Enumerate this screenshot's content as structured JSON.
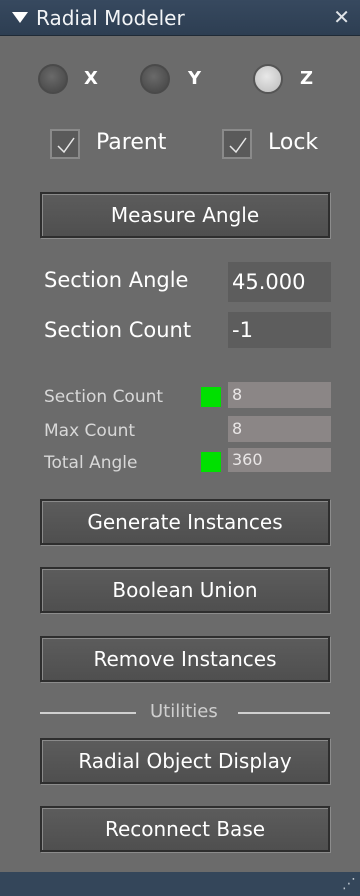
{
  "window": {
    "title": "Radial Modeler"
  },
  "axes": [
    {
      "label": "X",
      "selected": false
    },
    {
      "label": "Y",
      "selected": false
    },
    {
      "label": "Z",
      "selected": true
    }
  ],
  "options": {
    "parent": {
      "label": "Parent",
      "checked": true
    },
    "lock": {
      "label": "Lock",
      "checked": true
    }
  },
  "buttons": {
    "measure_angle": "Measure Angle",
    "generate_instances": "Generate Instances",
    "boolean_union": "Boolean Union",
    "remove_instances": "Remove Instances",
    "radial_object_display": "Radial Object Display",
    "reconnect_base": "Reconnect Base"
  },
  "fields": {
    "section_angle": {
      "label": "Section Angle",
      "value": "45.000"
    },
    "section_count": {
      "label": "Section Count",
      "value": "-1"
    }
  },
  "stats": {
    "section_count": {
      "label": "Section Count",
      "value": "8",
      "status_color": "#00e000"
    },
    "max_count": {
      "label": "Max Count",
      "value": "8"
    },
    "total_angle": {
      "label": "Total Angle",
      "value": "360",
      "status_color": "#00e000"
    }
  },
  "separator": {
    "label": "Utilities"
  }
}
